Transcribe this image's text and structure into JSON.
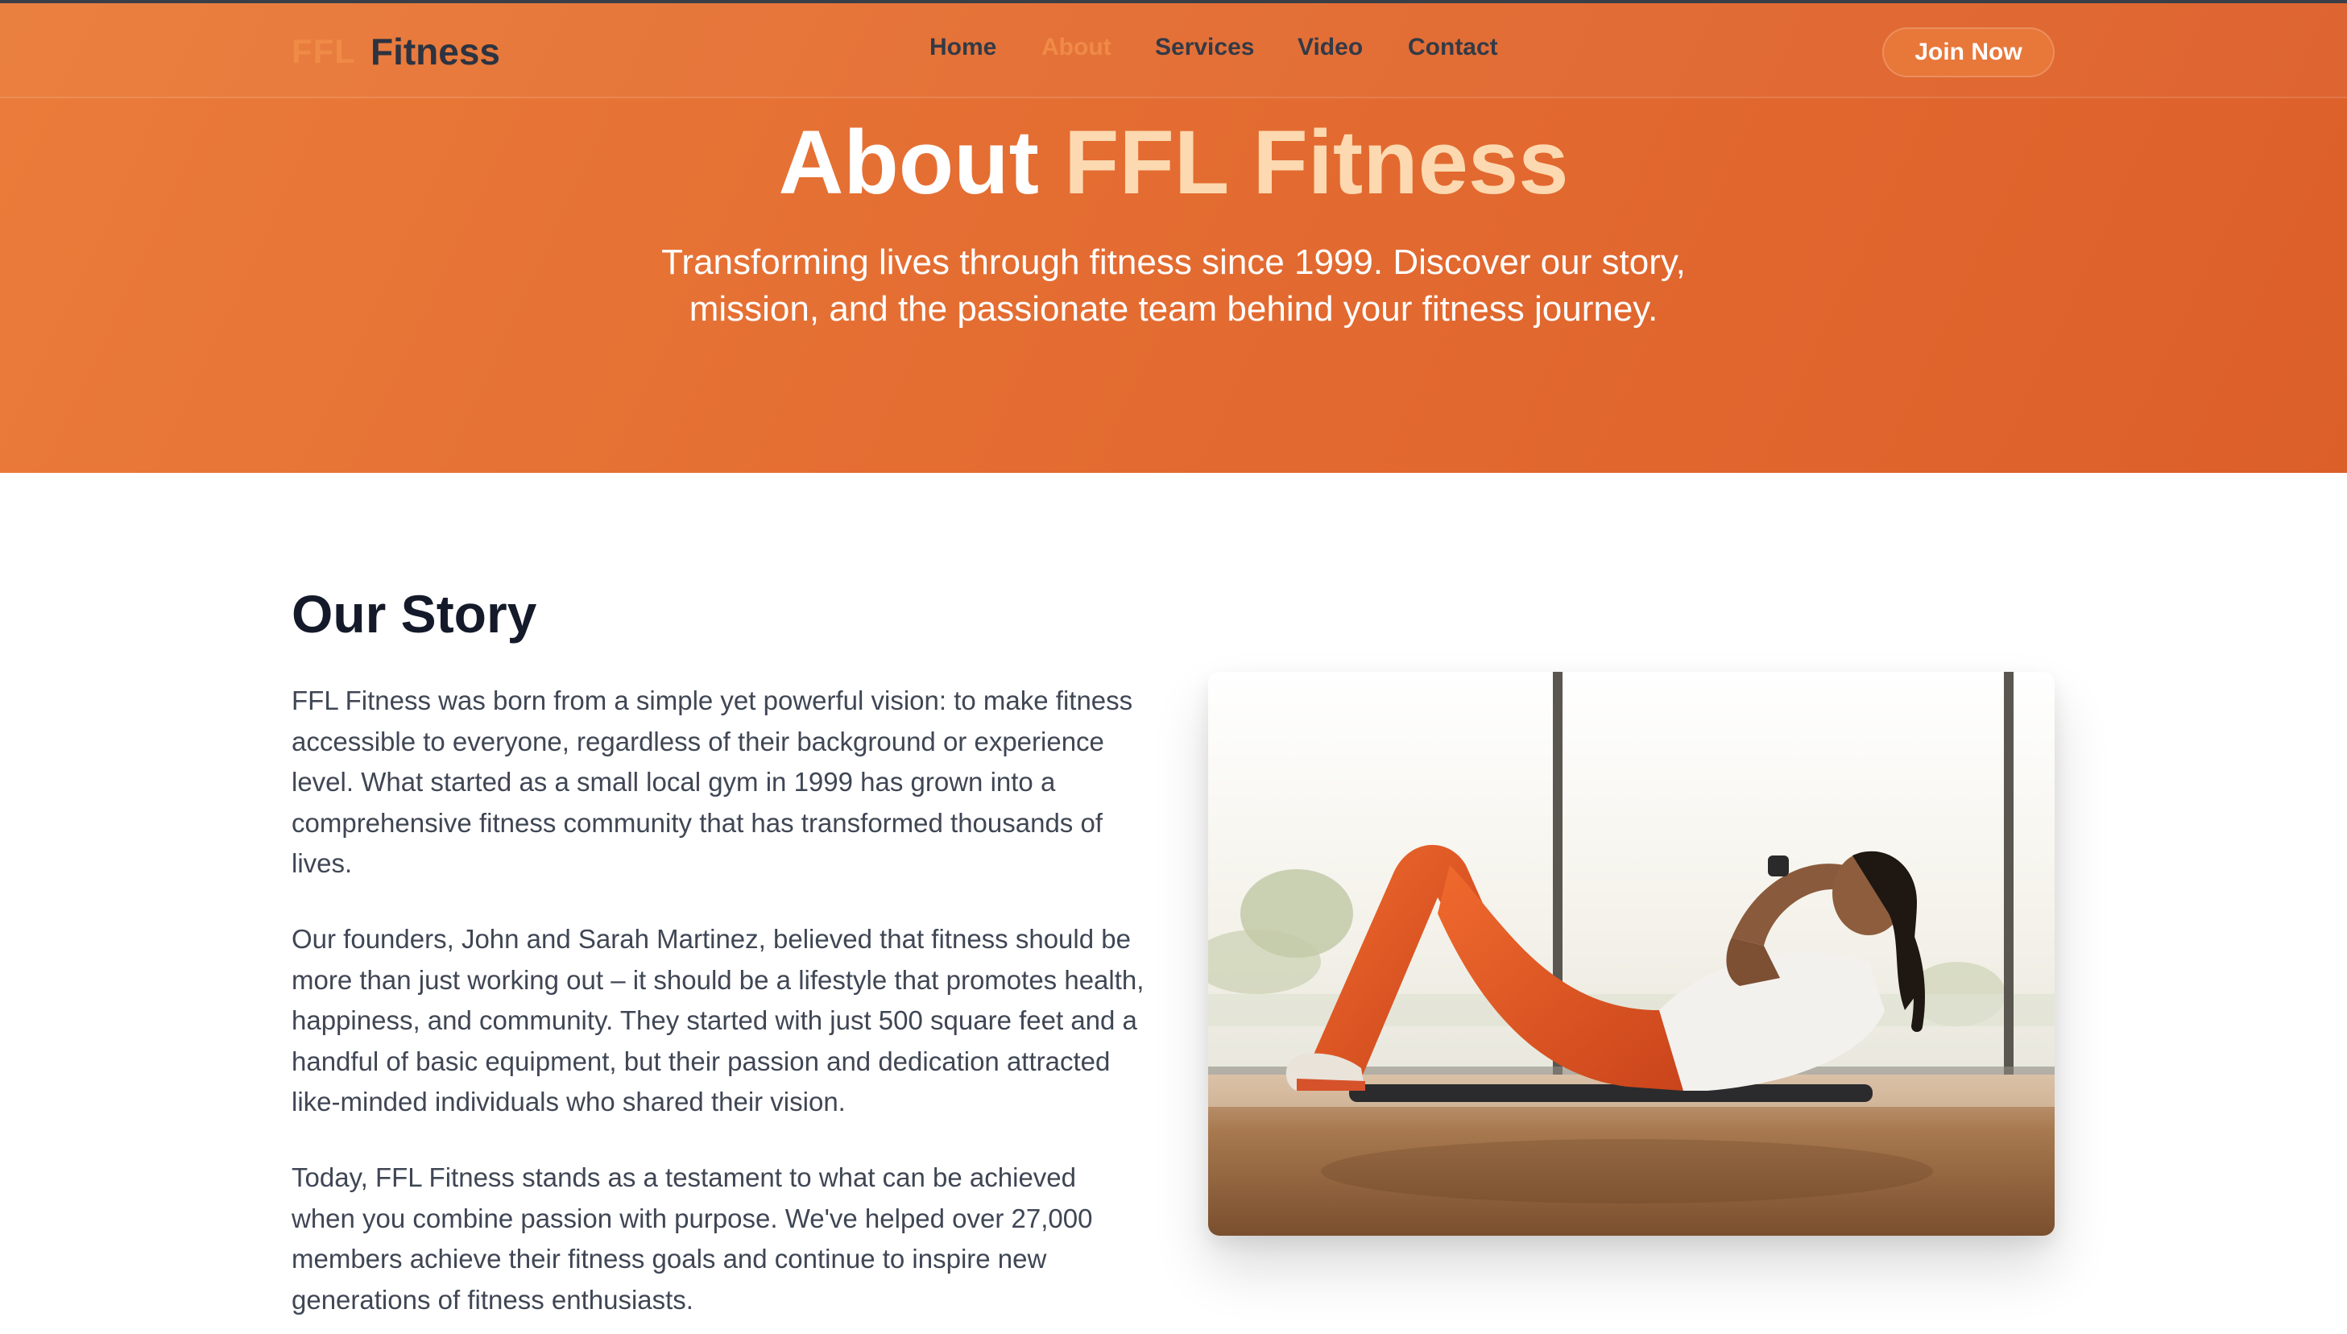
{
  "nav": {
    "logo_mark": "FFL",
    "logo_text": "Fitness",
    "items": [
      {
        "label": "Home",
        "active": false
      },
      {
        "label": "About",
        "active": true
      },
      {
        "label": "Services",
        "active": false
      },
      {
        "label": "Video",
        "active": false
      },
      {
        "label": "Contact",
        "active": false
      }
    ],
    "cta_label": "Join Now"
  },
  "hero": {
    "title_lead": "About",
    "title_accent": "FFL Fitness",
    "subtitle": "Transforming lives through fitness since 1999. Discover our story, mission, and the passionate team behind your fitness journey."
  },
  "story": {
    "heading": "Our Story",
    "paragraphs": [
      "FFL Fitness was born from a simple yet powerful vision: to make fitness accessible to everyone, regardless of their background or experience level. What started as a small local gym in 1999 has grown into a comprehensive fitness community that has transformed thousands of lives.",
      "Our founders, John and Sarah Martinez, believed that fitness should be more than just working out – it should be a lifestyle that promotes health, happiness, and community. They started with just 500 square feet and a handful of basic equipment, but their passion and dedication attracted like-minded individuals who shared their vision.",
      "Today, FFL Fitness stands as a testament to what can be achieved when you combine passion with purpose. We've helped over 27,000 members achieve their fitness goals and continue to inspire new generations of fitness enthusiasts."
    ]
  },
  "colors": {
    "brand_orange": "#e8773a",
    "accent_cream": "#fcd9b0",
    "heading_dark": "#151a2a"
  }
}
